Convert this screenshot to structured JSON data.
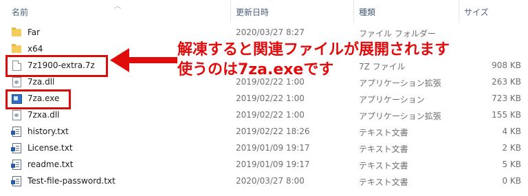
{
  "columns": {
    "name": "名前",
    "date": "更新日時",
    "type": "種類",
    "size": "サイズ"
  },
  "files": [
    {
      "name": "Far",
      "date": "2020/03/27 8:27",
      "type": "ファイル フォルダー",
      "size": "",
      "icon": "folder-icon"
    },
    {
      "name": "x64",
      "date": "",
      "type": "",
      "size": "",
      "icon": "folder-icon"
    },
    {
      "name": "7z1900-extra.7z",
      "date": "2020/03/27 8:27",
      "type": "7Z ファイル",
      "size": "908 KB",
      "icon": "file-icon"
    },
    {
      "name": "7za.dll",
      "date": "2019/02/22 1:00",
      "type": "アプリケーション拡張",
      "size": "263 KB",
      "icon": "dll-icon"
    },
    {
      "name": "7za.exe",
      "date": "2019/02/22 1:00",
      "type": "アプリケーション",
      "size": "723 KB",
      "icon": "exe-icon"
    },
    {
      "name": "7zxa.dll",
      "date": "2019/02/22 1:00",
      "type": "アプリケーション拡張",
      "size": "155 KB",
      "icon": "dll-icon"
    },
    {
      "name": "history.txt",
      "date": "2019/02/22 18:26",
      "type": "テキスト文書",
      "size": "4 KB",
      "icon": "txt-icon"
    },
    {
      "name": "License.txt",
      "date": "2019/01/09 19:17",
      "type": "テキスト文書",
      "size": "2 KB",
      "icon": "txt-icon"
    },
    {
      "name": "readme.txt",
      "date": "2019/01/09 19:17",
      "type": "テキスト文書",
      "size": "5 KB",
      "icon": "txt-icon"
    },
    {
      "name": "Test-file-password.txt",
      "date": "2020/03/27 8:00",
      "type": "テキスト文書",
      "size": "0 KB",
      "icon": "txt-icon"
    }
  ],
  "annotation": {
    "line1": "解凍すると関連ファイルが展開されます",
    "line2": "使うのは7za.exeです",
    "color": "#e00b0b"
  }
}
